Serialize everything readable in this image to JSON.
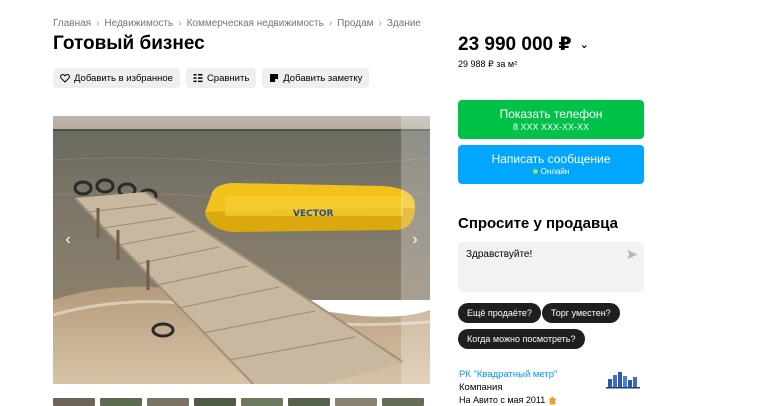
{
  "breadcrumb": [
    "Главная",
    "Недвижимость",
    "Коммерческая недвижимость",
    "Продам",
    "Здание"
  ],
  "title": "Готовый бизнес",
  "actions": {
    "favorite": "Добавить в избранное",
    "compare": "Сравнить",
    "note": "Добавить заметку"
  },
  "gallery": {
    "prev_icon": "chevron-left-icon",
    "next_icon": "chevron-right-icon",
    "thumbnail_count": 8
  },
  "price": {
    "value": "23 990 000 ₽",
    "per_sqm": "29 988 ₽ за м²"
  },
  "contact": {
    "phone_label": "Показать телефон",
    "phone_masked": "8 XXX XXX-XX-XX",
    "message_label": "Написать сообщение",
    "online_label": "Онлайн"
  },
  "ask": {
    "title": "Спросите у продавца",
    "default_text": "Здравствуйте!",
    "chips": [
      "Ещё продаёте?",
      "Торг уместен?",
      "Когда можно посмотреть?"
    ]
  },
  "seller": {
    "name": "РК \"Квадратный метр\"",
    "type": "Компания",
    "since": "На Авито с мая 2011"
  },
  "colors": {
    "phone_button": "#00c248",
    "message_button": "#00a6ff",
    "link": "#0099f7",
    "chip": "#1f1f1f"
  }
}
